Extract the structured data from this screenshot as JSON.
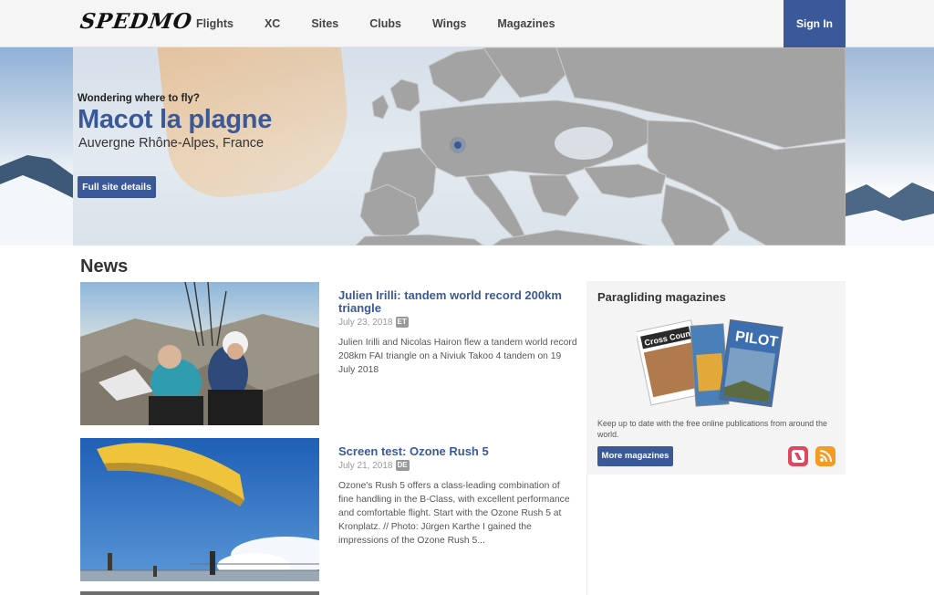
{
  "header": {
    "logo": "SPEDMO",
    "nav": [
      "Flights",
      "XC",
      "Sites",
      "Clubs",
      "Wings",
      "Magazines"
    ],
    "sign_in": "Sign In"
  },
  "hero": {
    "eyebrow": "Wondering where to fly?",
    "title": "Macot la plagne",
    "subtitle": "Auvergne Rhône-Alpes, France",
    "button": "Full site details"
  },
  "news": {
    "heading": "News",
    "items": [
      {
        "headline": "Julien Irilli: tandem world record 200km triangle",
        "date": "July 23, 2018",
        "lang": "ET",
        "body": "Julien Irilli and Nicolas Hairon flew a tandem world record 208km FAI triangle on a Niviuk Takoo 4 tandem on 19 July 2018"
      },
      {
        "headline": "Screen test: Ozone Rush 5",
        "date": "July 21, 2018",
        "lang": "DE",
        "body": "Ozone's Rush 5 offers a class-leading combination of fine handling in the B-Class, with excellent performance and comfortable flight. Start with the Ozone Rush 5 at Kronplatz. // Photo: Jürgen Karthe I gained the impressions of the Ozone Rush 5..."
      }
    ]
  },
  "sidebar": {
    "title": "Paragliding magazines",
    "text": "Keep up to date with the free online publications from around the world.",
    "button": "More magazines",
    "magazine_covers": [
      "Cross Country",
      "PILOT"
    ],
    "icons": [
      "apple-news-icon",
      "rss-icon"
    ]
  },
  "colors": {
    "accent": "#3b5998",
    "header_bg": "#f5f5f5",
    "map_land": "#a3a3a3"
  }
}
